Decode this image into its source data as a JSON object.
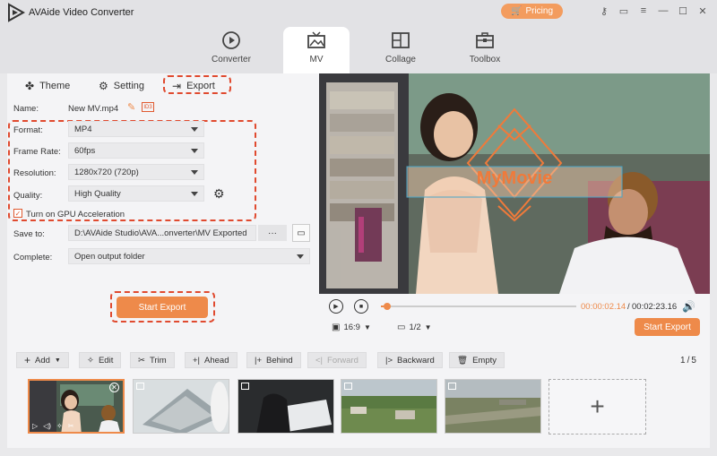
{
  "app": {
    "title": "AVAide Video Converter",
    "pricing_label": "Pricing"
  },
  "tabs": [
    {
      "label": "Converter"
    },
    {
      "label": "MV"
    },
    {
      "label": "Collage"
    },
    {
      "label": "Toolbox"
    }
  ],
  "subtabs": [
    {
      "label": "Theme"
    },
    {
      "label": "Setting"
    },
    {
      "label": "Export"
    }
  ],
  "export": {
    "name_label": "Name:",
    "name_value": "New MV.mp4",
    "format_label": "Format:",
    "format_value": "MP4",
    "framerate_label": "Frame Rate:",
    "framerate_value": "60fps",
    "resolution_label": "Resolution:",
    "resolution_value": "1280x720 (720p)",
    "quality_label": "Quality:",
    "quality_value": "High Quality",
    "gpu_label": "Turn on GPU Acceleration",
    "gpu_checked": true,
    "saveto_label": "Save to:",
    "saveto_value": "D:\\AVAide Studio\\AVA...onverter\\MV Exported",
    "saveto_more": "···",
    "complete_label": "Complete:",
    "complete_value": "Open output folder",
    "start_export_label": "Start Export"
  },
  "preview": {
    "overlay_text": "MyMovie",
    "time_current": "00:00:02.14",
    "time_separator": "/",
    "time_total": "00:02:23.16",
    "aspect_ratio": "16:9",
    "page": "1/2",
    "start_export_label": "Start Export",
    "progress_fraction": 0.015
  },
  "toolbar": {
    "add": "Add",
    "edit": "Edit",
    "trim": "Trim",
    "ahead": "Ahead",
    "behind": "Behind",
    "forward": "Forward",
    "backward": "Backward",
    "empty": "Empty",
    "page_current": "1",
    "page_separator": "/",
    "page_total": "5"
  },
  "colors": {
    "accent": "#ee8a4a",
    "highlight": "#e04a2f",
    "overlay": "#f07a3a"
  }
}
